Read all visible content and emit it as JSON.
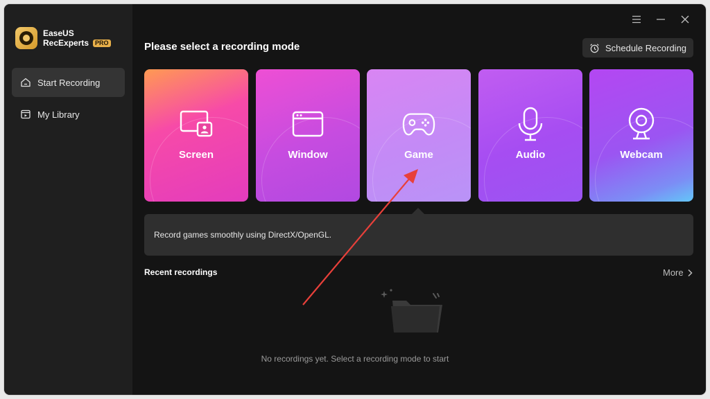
{
  "brand": {
    "name_line1": "EaseUS",
    "name_line2": "RecExperts",
    "badge": "PRO"
  },
  "sidebar": {
    "items": [
      {
        "label": "Start Recording",
        "icon": "home-icon",
        "active": true
      },
      {
        "label": "My Library",
        "icon": "library-icon",
        "active": false
      }
    ]
  },
  "window_controls": [
    "menu-icon",
    "minimize-icon",
    "close-icon"
  ],
  "main": {
    "title": "Please select a recording mode",
    "schedule_label": "Schedule Recording",
    "modes": [
      {
        "label": "Screen",
        "icon": "screen-icon"
      },
      {
        "label": "Window",
        "icon": "window-icon"
      },
      {
        "label": "Game",
        "icon": "gamepad-icon"
      },
      {
        "label": "Audio",
        "icon": "microphone-icon"
      },
      {
        "label": "Webcam",
        "icon": "webcam-icon"
      }
    ],
    "tooltip": "Record games smoothly using DirectX/OpenGL.",
    "recent_title": "Recent recordings",
    "more_label": "More",
    "empty_text": "No recordings yet. Select a recording mode to start"
  },
  "colors": {
    "window_bg": "#141414",
    "sidebar_bg": "#1f1f1f",
    "annotation_arrow": "#e8403a"
  }
}
